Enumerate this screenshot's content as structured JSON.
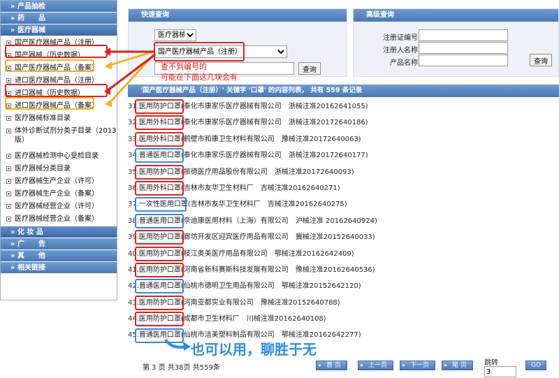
{
  "sidebar": {
    "sections": [
      {
        "label": "» 产品抽检"
      },
      {
        "label": "» 药　　品"
      },
      {
        "label": "» 医疗器械"
      }
    ],
    "items": [
      {
        "label": "国产医疗器械产品（注册）"
      },
      {
        "label": "国产器械（历史数据）"
      },
      {
        "label": "国产医疗器械产品（备案）"
      },
      {
        "label": "进口医疗器械产品（注册）"
      },
      {
        "label": "进口器械（历史数据）"
      },
      {
        "label": "进口医疗器械产品（备案）"
      },
      {
        "label": "医疗器械标准目录"
      },
      {
        "label": "体外诊断试剂分类子目录（2013版）"
      },
      {
        "label": "医疗器械检测中心受检目录"
      },
      {
        "label": "医疗器械分类目录"
      },
      {
        "label": "医疗器械生产企业（许可）"
      },
      {
        "label": "医疗器械生产企业（备案）"
      },
      {
        "label": "医疗器械经营企业（许可）"
      },
      {
        "label": "医疗器械经营企业（备案）"
      }
    ],
    "bottom_sections": [
      {
        "label": "» 化 妆 品"
      },
      {
        "label": "» 广　　告"
      },
      {
        "label": "» 其　　他"
      },
      {
        "label": "» 相关链接"
      }
    ]
  },
  "quick_search": {
    "title": "快速查询",
    "category_value": "医疗器械",
    "product_value": "国产医疗器械产品（注册）",
    "keyword_value": "",
    "search_label": "查询"
  },
  "advanced_search": {
    "title": "高级查询",
    "fields": [
      {
        "label": "注册证编号",
        "value": ""
      },
      {
        "label": "注册人名称",
        "value": ""
      },
      {
        "label": "产品名称",
        "value": ""
      }
    ],
    "search_label": "查询"
  },
  "results": {
    "header": "'国产医疗器械产品（注册）' 关键字 '口罩' 的内容列表， 共有 559 条记录",
    "rows": [
      {
        "n": "31.",
        "name": "医用防护口罩",
        "company": "(泰化市康家乐医疗器械有限公司",
        "reg": "浙械注准20162641055)"
      },
      {
        "n": "32.",
        "name": "医用外科口罩",
        "company": "(泰化市康家乐医疗器械有限公司",
        "reg": "浙械注准20172640186)"
      },
      {
        "n": "33.",
        "name": "医用外科口罩",
        "company": "(鹤壁市和康卫生材料有限公司",
        "reg": "豫械注准20172640063)"
      },
      {
        "n": "34.",
        "name": "普通医用口罩",
        "company": "(泰化市康家乐医疗器械有限公司",
        "reg": "浙械注准20172640177)"
      },
      {
        "n": "35.",
        "name": "医用防护口罩",
        "company": "(振德医疗用品股份有限公司",
        "reg": "浙械注准20172640093)"
      },
      {
        "n": "36.",
        "name": "医用外科口罩",
        "company": "(吉林市友华卫生材料厂",
        "reg": "吉械注准20162640271)"
      },
      {
        "n": "37.",
        "name": "一次性医用口罩",
        "company": "(吉林市友华卫生材料厂",
        "reg": "吉械注准20162640275)"
      },
      {
        "n": "38.",
        "name": "普通医用口罩",
        "company": "(奈迪康医用材料（上海）有限公司",
        "reg": "沪械注准 20162640924)"
      },
      {
        "n": "39.",
        "name": "医用防护口罩",
        "company": "(廊坊开发区迎宾医疗用品有限公司",
        "reg": "冀械注准20152640033)"
      },
      {
        "n": "40.",
        "name": "医用防护口罩",
        "company": "(枝江奥美医疗用品有限公司",
        "reg": "鄂械注准20162642409)"
      },
      {
        "n": "41.",
        "name": "医用防护口罩",
        "company": "(河南省新科赛斯科技发展有限公司",
        "reg": "豫械注准20162640536)"
      },
      {
        "n": "42.",
        "name": "普通医用口罩",
        "company": "(仙桃市德明卫生用品有限公司",
        "reg": "鄂械注准20152642120)"
      },
      {
        "n": "43.",
        "name": "医用防护口罩",
        "company": "(河南亚都实业有限公司",
        "reg": "豫械注准20152640788)"
      },
      {
        "n": "44.",
        "name": "医用防护口罩",
        "company": "(成都市卫生材料厂",
        "reg": "川械注准20162640108)"
      },
      {
        "n": "45.",
        "name": "普通医用口罩",
        "company": "(仙桃市洁美塑料制品有限公司",
        "reg": "鄂械注准20162642277)"
      }
    ]
  },
  "pager": {
    "info": "第 3 页 共38页 共559条",
    "first": "首 页",
    "prev": "上一页",
    "next": "下一页",
    "last": "尾 页",
    "jump_label": "跳转",
    "jump_value": "3",
    "go": "GO"
  },
  "annotations": {
    "note_line1": "查不到编号的",
    "note_line2": "可能在下面这几块会有",
    "blue_note": "也可以用，聊胜于无",
    "colors": {
      "red": "#e02020",
      "yellow": "#f3b51a",
      "blue": "#2f8be0"
    }
  }
}
